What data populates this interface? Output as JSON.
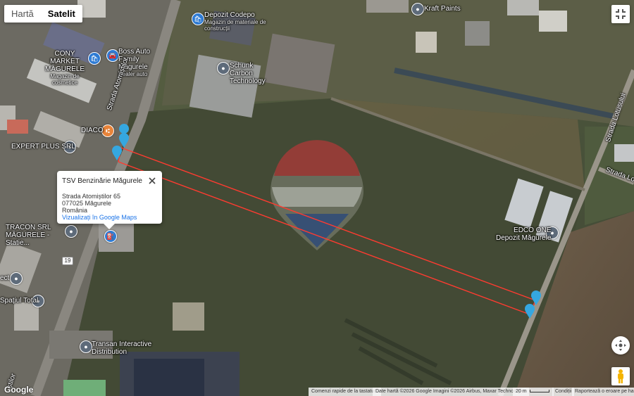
{
  "map_type_toggle": {
    "map_label": "Hartă",
    "satellite_label": "Satelit",
    "selected": "Satelit"
  },
  "place_labels": {
    "depozit_codepo": "Depozit Codepo",
    "depozit_codepo_sub": "Magazin de materiale de construcții",
    "kraft_paints": "Kraft Paints",
    "cony_market": "CONY MARKET MĂGURELE",
    "cony_market_sub": "Magazin de cosmetice",
    "boss_auto": "Boss Auto Family Măgurele",
    "boss_auto_sub": "Dealer auto",
    "schunk": "Schunk Carbon Technology",
    "diaco": "DIACO",
    "expert_plus": "EXPERT PLUS SRL",
    "tracon": "TRACON SRL MĂGURELE - Statie...",
    "ect": "ect",
    "spatiul_total": "Spațiul Total",
    "edco": "EDCO ONE",
    "edco_sub": "Depozit Măgurele",
    "transan": "Transan Interactive Distribution"
  },
  "street_labels": {
    "atomistilor": "Strada Atomiștilor",
    "lotusului": "Strada Lotusului",
    "lotusului_partial": "Strada Lot",
    "atomistilor_bottom": "știlor"
  },
  "road_shield": "19",
  "info_window": {
    "title": "TSV Benzinărie Măgurele",
    "address_line1": "Strada Atomiștilor 65",
    "address_line2": "077025 Măgurele",
    "address_line3": "România",
    "link": "Vizualizați în Google Maps"
  },
  "attribution": {
    "keyboard": "Comenzi rapide de la tastatură",
    "data": "Date hartă ©2026 Google Imagini ©2026 Airbus, Maxar Technologies",
    "scale": "20 m",
    "terms": "Condiții",
    "report": "Raportează o eroare pe hartă"
  },
  "google_logo": "Google",
  "icons": {
    "fullscreen": "fullscreen-exit-icon",
    "camera": "camera-control-icon",
    "pegman": "pegman-icon",
    "close": "close-icon",
    "watermark": "remax-balloon-watermark"
  },
  "colors": {
    "route_line": "#ff3b30",
    "marker_blue": "#35a7e0",
    "link_blue": "#1a73e8",
    "pegman": "#f4b400"
  }
}
